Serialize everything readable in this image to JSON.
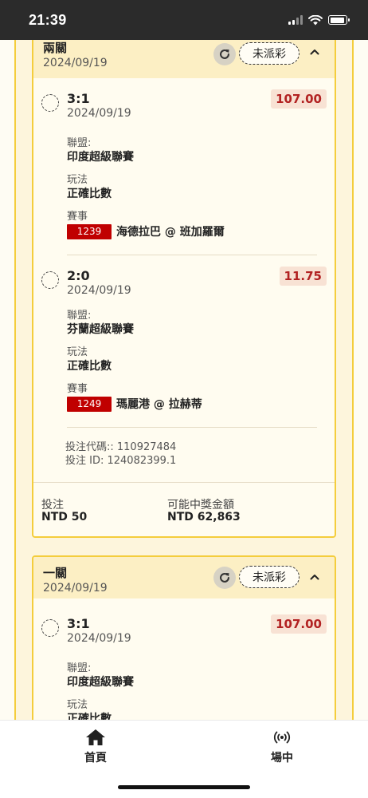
{
  "status_bar": {
    "time": "21:39"
  },
  "cards": [
    {
      "title": "兩關",
      "date": "2024/09/19",
      "status": "未派彩",
      "selections": [
        {
          "score": "3:1",
          "date": "2024/09/19",
          "odds": "107.00",
          "league_label": "聯盟:",
          "league": "印度超級聯賽",
          "market_label": "玩法",
          "market": "正確比數",
          "event_label": "賽事",
          "match_id": "1239",
          "match": "海德拉巴 @ 班加羅爾"
        },
        {
          "score": "2:0",
          "date": "2024/09/19",
          "odds": "11.75",
          "league_label": "聯盟:",
          "league": "芬蘭超級聯賽",
          "market_label": "玩法",
          "market": "正確比數",
          "event_label": "賽事",
          "match_id": "1249",
          "match": "瑪麗港 @ 拉赫蒂"
        }
      ],
      "bet_code": "投注代碼:: 110927484",
      "bet_id": "投注 ID: 124082399.1",
      "stake_label": "投注",
      "stake": "NTD 50",
      "payout_label": "可能中獎金額",
      "payout": "NTD 62,863"
    },
    {
      "title": "一關",
      "date": "2024/09/19",
      "status": "未派彩",
      "selections": [
        {
          "score": "3:1",
          "date": "2024/09/19",
          "odds": "107.00",
          "league_label": "聯盟:",
          "league": "印度超級聯賽",
          "market_label": "玩法",
          "market": "正確比數"
        }
      ]
    }
  ],
  "nav": {
    "home": "首頁",
    "live": "場中"
  },
  "colors": {
    "accent": "#f4cd3c",
    "header_bg": "#fcefc4",
    "odds_text": "#b22222",
    "match_badge": "#c00000"
  },
  "icons": {
    "refresh": "refresh-icon",
    "collapse": "chevron-up-icon",
    "home": "home-icon",
    "live": "broadcast-icon"
  }
}
